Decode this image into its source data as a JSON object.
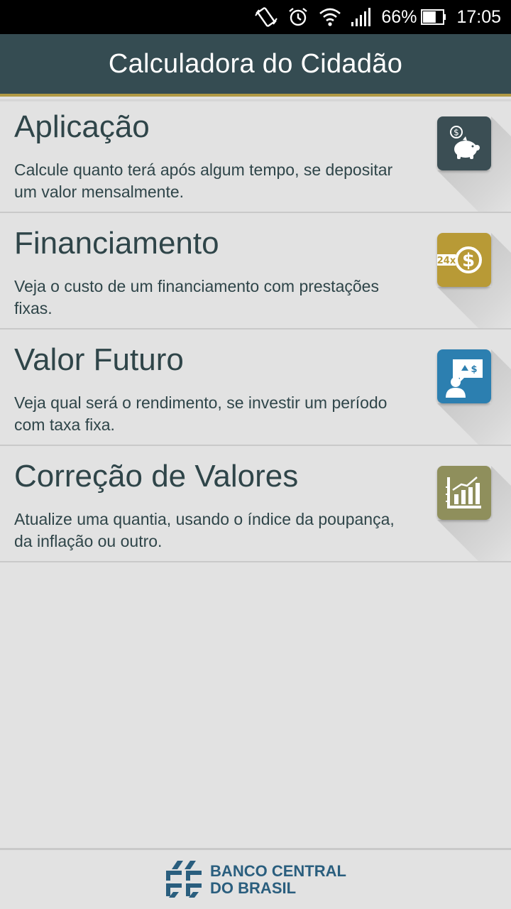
{
  "status_bar": {
    "battery_percent": "66%",
    "time": "17:05",
    "icons": [
      "vibrate-icon",
      "alarm-icon",
      "wifi-icon",
      "signal-icon",
      "battery-icon"
    ],
    "battery_level": 0.66
  },
  "app_bar": {
    "title": "Calculadora do Cidadão",
    "background": "#354c52",
    "accent": "#b19a45"
  },
  "items": [
    {
      "title": "Aplicação",
      "description": "Calcule quanto terá após algum tempo, se depositar um valor mensalmente.",
      "icon": "piggy-bank-icon",
      "tile_color": "#3b4e54"
    },
    {
      "title": "Financiamento",
      "description": "Veja o custo de um financiamento com prestações fixas.",
      "icon": "installments-24x-icon",
      "icon_text": "24x",
      "tile_color": "#b89a36"
    },
    {
      "title": "Valor Futuro",
      "description": "Veja qual será o rendimento, se investir um período com taxa fixa.",
      "icon": "investor-presentation-icon",
      "tile_color": "#2c7fb0"
    },
    {
      "title": "Correção de Valores",
      "description": "Atualize uma quantia, usando o índice da poupança, da inflação ou outro.",
      "icon": "bar-chart-icon",
      "tile_color": "#8f8f5c"
    }
  ],
  "footer": {
    "brand_line1": "BANCO CENTRAL",
    "brand_line2": "DO BRASIL",
    "brand_color": "#2a5e7e"
  }
}
